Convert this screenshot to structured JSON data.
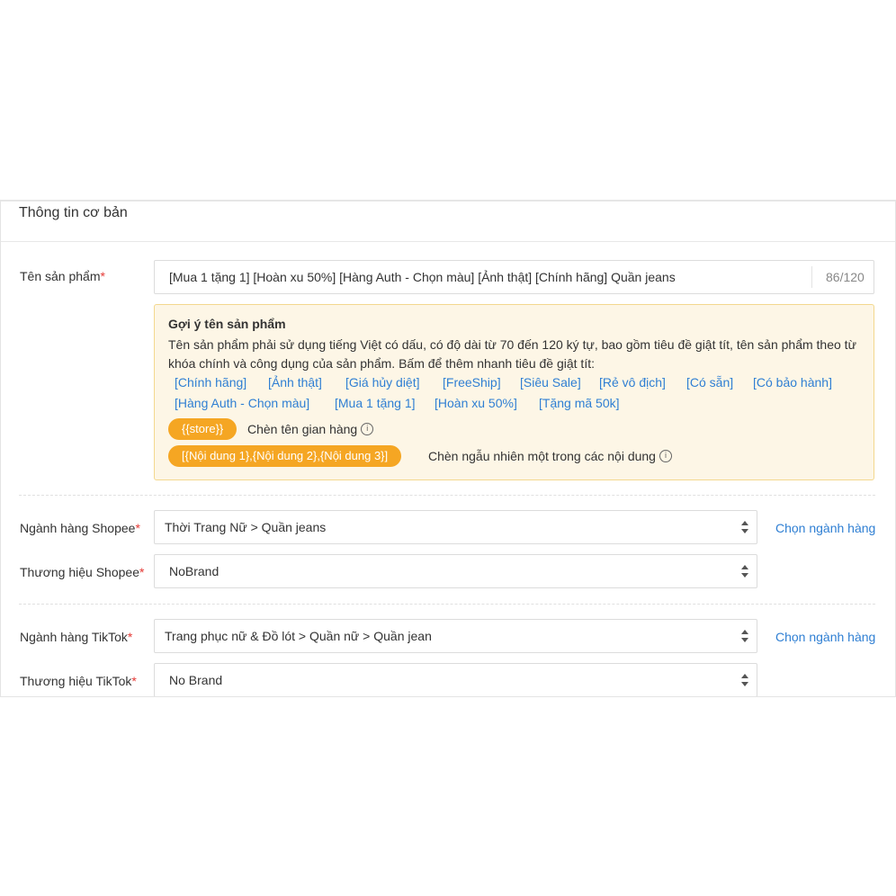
{
  "section": {
    "title": "Thông tin cơ bản"
  },
  "product_name": {
    "label": "Tên sản phẩm",
    "required_mark": "*",
    "value": "[Mua 1 tặng 1] [Hoàn xu 50%] [Hàng Auth - Chọn màu] [Ảnh thật] [Chính hãng] Quần jeans",
    "counter": "86/120"
  },
  "suggestion": {
    "title": "Gợi ý tên sản phẩm",
    "description": "Tên sản phẩm phải sử dụng tiếng Việt có dấu, có độ dài từ 70 đến 120 ký tự, bao gồm tiêu đề giật tít, tên sản phẩm theo từ khóa chính và công dụng của sản phẩm. Bấm để thêm nhanh tiêu đề giật tít:",
    "tags": [
      "[Chính hãng]",
      "[Ảnh thật]",
      "[Giá hủy diệt]",
      "[FreeShip]",
      "[Siêu Sale]",
      "[Rẻ vô địch]",
      "[Có sẵn]",
      "[Có bảo hành]",
      "[Hàng Auth - Chọn màu]",
      "[Mua 1 tặng 1]",
      "[Hoàn xu 50%]",
      "[Tặng mã 50k]"
    ],
    "store_pill": "{{store}}",
    "store_note": "Chèn tên gian hàng",
    "random_pill": "[{Nội dung 1},{Nội dung 2},{Nội dung 3}]",
    "random_note": "Chèn ngẫu nhiên một trong các nội dung"
  },
  "shopee": {
    "category_label": "Ngành hàng Shopee",
    "category_value": "Thời Trang Nữ > Quần jeans",
    "category_link": "Chọn ngành hàng",
    "brand_label": "Thương hiệu Shopee",
    "brand_value": "NoBrand"
  },
  "tiktok": {
    "category_label": "Ngành hàng TikTok",
    "category_value": "Trang phục nữ & Đồ lót > Quần nữ > Quần jean",
    "category_link": "Chọn ngành hàng",
    "brand_label": "Thương hiệu TikTok",
    "brand_value": "No Brand"
  },
  "icons": {
    "info": "info-circle-icon",
    "select": "sort-arrows-icon"
  },
  "colors": {
    "accent": "#f5a623",
    "link": "#2f7fd3",
    "required": "#e53935",
    "hint_bg": "#fdf6e6"
  }
}
